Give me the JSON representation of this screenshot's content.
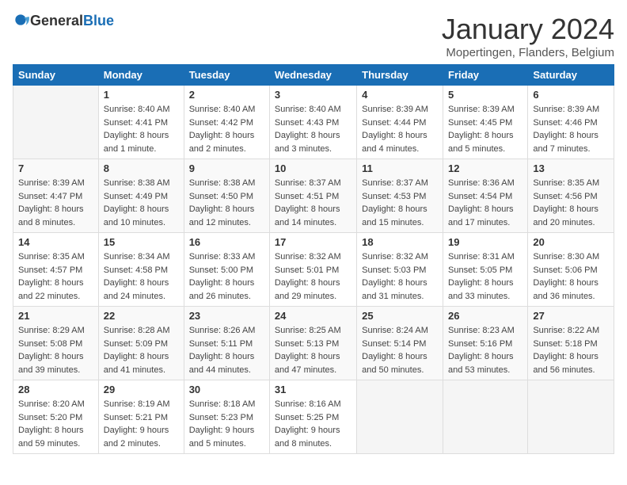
{
  "logo": {
    "text_general": "General",
    "text_blue": "Blue"
  },
  "title": "January 2024",
  "location": "Mopertingen, Flanders, Belgium",
  "days_of_week": [
    "Sunday",
    "Monday",
    "Tuesday",
    "Wednesday",
    "Thursday",
    "Friday",
    "Saturday"
  ],
  "weeks": [
    [
      {
        "day": "",
        "info": ""
      },
      {
        "day": "1",
        "info": "Sunrise: 8:40 AM\nSunset: 4:41 PM\nDaylight: 8 hours\nand 1 minute."
      },
      {
        "day": "2",
        "info": "Sunrise: 8:40 AM\nSunset: 4:42 PM\nDaylight: 8 hours\nand 2 minutes."
      },
      {
        "day": "3",
        "info": "Sunrise: 8:40 AM\nSunset: 4:43 PM\nDaylight: 8 hours\nand 3 minutes."
      },
      {
        "day": "4",
        "info": "Sunrise: 8:39 AM\nSunset: 4:44 PM\nDaylight: 8 hours\nand 4 minutes."
      },
      {
        "day": "5",
        "info": "Sunrise: 8:39 AM\nSunset: 4:45 PM\nDaylight: 8 hours\nand 5 minutes."
      },
      {
        "day": "6",
        "info": "Sunrise: 8:39 AM\nSunset: 4:46 PM\nDaylight: 8 hours\nand 7 minutes."
      }
    ],
    [
      {
        "day": "7",
        "info": "Sunrise: 8:39 AM\nSunset: 4:47 PM\nDaylight: 8 hours\nand 8 minutes."
      },
      {
        "day": "8",
        "info": "Sunrise: 8:38 AM\nSunset: 4:49 PM\nDaylight: 8 hours\nand 10 minutes."
      },
      {
        "day": "9",
        "info": "Sunrise: 8:38 AM\nSunset: 4:50 PM\nDaylight: 8 hours\nand 12 minutes."
      },
      {
        "day": "10",
        "info": "Sunrise: 8:37 AM\nSunset: 4:51 PM\nDaylight: 8 hours\nand 14 minutes."
      },
      {
        "day": "11",
        "info": "Sunrise: 8:37 AM\nSunset: 4:53 PM\nDaylight: 8 hours\nand 15 minutes."
      },
      {
        "day": "12",
        "info": "Sunrise: 8:36 AM\nSunset: 4:54 PM\nDaylight: 8 hours\nand 17 minutes."
      },
      {
        "day": "13",
        "info": "Sunrise: 8:35 AM\nSunset: 4:56 PM\nDaylight: 8 hours\nand 20 minutes."
      }
    ],
    [
      {
        "day": "14",
        "info": "Sunrise: 8:35 AM\nSunset: 4:57 PM\nDaylight: 8 hours\nand 22 minutes."
      },
      {
        "day": "15",
        "info": "Sunrise: 8:34 AM\nSunset: 4:58 PM\nDaylight: 8 hours\nand 24 minutes."
      },
      {
        "day": "16",
        "info": "Sunrise: 8:33 AM\nSunset: 5:00 PM\nDaylight: 8 hours\nand 26 minutes."
      },
      {
        "day": "17",
        "info": "Sunrise: 8:32 AM\nSunset: 5:01 PM\nDaylight: 8 hours\nand 29 minutes."
      },
      {
        "day": "18",
        "info": "Sunrise: 8:32 AM\nSunset: 5:03 PM\nDaylight: 8 hours\nand 31 minutes."
      },
      {
        "day": "19",
        "info": "Sunrise: 8:31 AM\nSunset: 5:05 PM\nDaylight: 8 hours\nand 33 minutes."
      },
      {
        "day": "20",
        "info": "Sunrise: 8:30 AM\nSunset: 5:06 PM\nDaylight: 8 hours\nand 36 minutes."
      }
    ],
    [
      {
        "day": "21",
        "info": "Sunrise: 8:29 AM\nSunset: 5:08 PM\nDaylight: 8 hours\nand 39 minutes."
      },
      {
        "day": "22",
        "info": "Sunrise: 8:28 AM\nSunset: 5:09 PM\nDaylight: 8 hours\nand 41 minutes."
      },
      {
        "day": "23",
        "info": "Sunrise: 8:26 AM\nSunset: 5:11 PM\nDaylight: 8 hours\nand 44 minutes."
      },
      {
        "day": "24",
        "info": "Sunrise: 8:25 AM\nSunset: 5:13 PM\nDaylight: 8 hours\nand 47 minutes."
      },
      {
        "day": "25",
        "info": "Sunrise: 8:24 AM\nSunset: 5:14 PM\nDaylight: 8 hours\nand 50 minutes."
      },
      {
        "day": "26",
        "info": "Sunrise: 8:23 AM\nSunset: 5:16 PM\nDaylight: 8 hours\nand 53 minutes."
      },
      {
        "day": "27",
        "info": "Sunrise: 8:22 AM\nSunset: 5:18 PM\nDaylight: 8 hours\nand 56 minutes."
      }
    ],
    [
      {
        "day": "28",
        "info": "Sunrise: 8:20 AM\nSunset: 5:20 PM\nDaylight: 8 hours\nand 59 minutes."
      },
      {
        "day": "29",
        "info": "Sunrise: 8:19 AM\nSunset: 5:21 PM\nDaylight: 9 hours\nand 2 minutes."
      },
      {
        "day": "30",
        "info": "Sunrise: 8:18 AM\nSunset: 5:23 PM\nDaylight: 9 hours\nand 5 minutes."
      },
      {
        "day": "31",
        "info": "Sunrise: 8:16 AM\nSunset: 5:25 PM\nDaylight: 9 hours\nand 8 minutes."
      },
      {
        "day": "",
        "info": ""
      },
      {
        "day": "",
        "info": ""
      },
      {
        "day": "",
        "info": ""
      }
    ]
  ]
}
